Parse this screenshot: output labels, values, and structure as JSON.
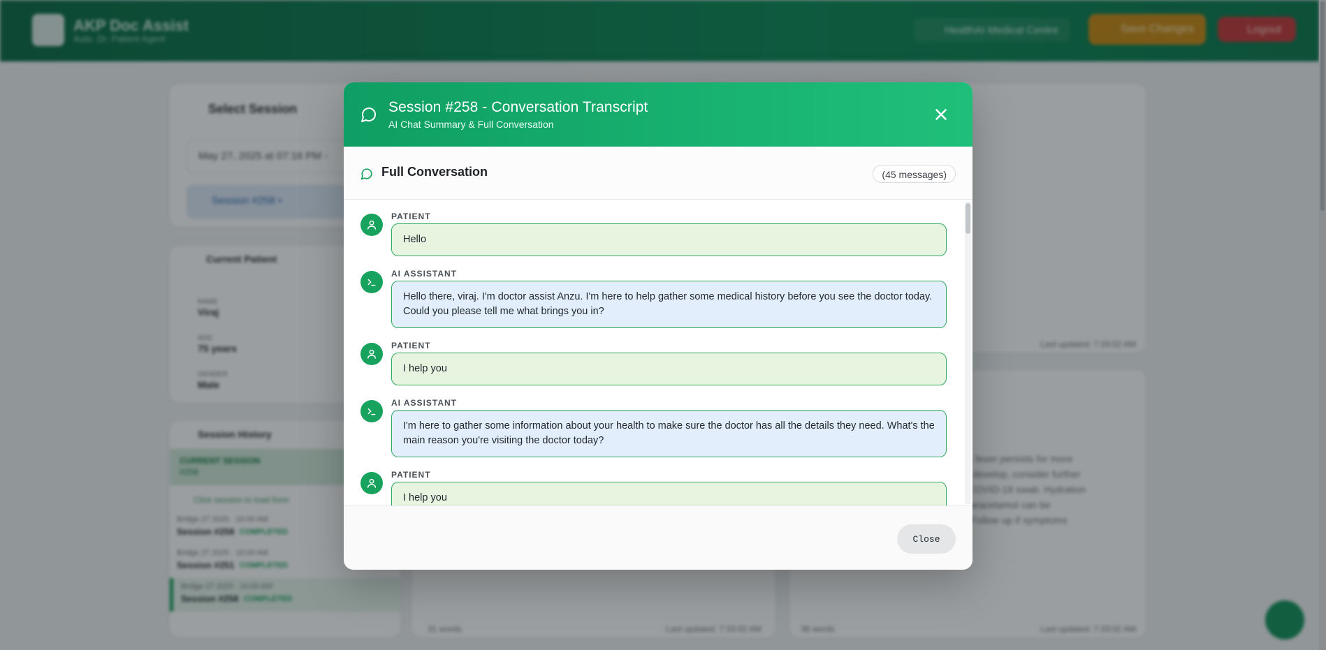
{
  "app": {
    "name": "AKP Doc Assist",
    "tagline": "Auto. Dr. Patient Agent",
    "clinic": "HealthAI Medical Centre",
    "save_label": "Save Changes",
    "logout_label": "Logout"
  },
  "background": {
    "select_session_title": "Select Session",
    "session_select_value": "May 27, 2025 at 07:16 PM - ",
    "session_pill": "Session #258 • ",
    "current_patient_title": "Current Patient",
    "patient_fields": [
      {
        "label": "NAME",
        "value": "Viraj"
      },
      {
        "label": "AGE",
        "value": "75 years"
      },
      {
        "label": "GENDER",
        "value": "Male"
      }
    ],
    "history_title": "Session History",
    "history_current": "CURRENT SESSION",
    "history_current_id": "#258",
    "history_hint": "Click session to load form",
    "history_items": [
      {
        "date": "Bridge 27 2025 · 10:00 AM",
        "title": "Session #258",
        "status": "COMPLETED"
      },
      {
        "date": "Bridge 27 2025 · 10:00 AM",
        "title": "Session #251",
        "status": "COMPLETED"
      },
      {
        "date": "Bridge 27 2025 · 10:00 AM",
        "title": "Session #258",
        "status": "COMPLETED"
      }
    ],
    "right_text": "if the fever persists for more\nable develop, consider further\nd a COVID-19 swab. Hydration\nus paracetamol can be\nres. Follow up if symptoms",
    "last_updated_1": "Last updated: 7:33:02 AM",
    "last_updated_2": "Last updated: 7:33:02 AM",
    "last_updated_3": "Last updated: 7:33:02 AM",
    "words_1": "31 words",
    "words_2": "38 words"
  },
  "modal": {
    "title": "Session #258 - Conversation Transcript",
    "subtitle": "AI Chat Summary & Full Conversation",
    "section_title": "Full Conversation",
    "message_count": "(45 messages)",
    "close_label": "Close",
    "messages": [
      {
        "role": "PATIENT",
        "type": "patient",
        "text": "Hello"
      },
      {
        "role": "AI ASSISTANT",
        "type": "ai",
        "text": "Hello there, viraj. I'm doctor assist Anzu. I'm here to help gather some medical history before you see the doctor today. Could you please tell me what brings you in?"
      },
      {
        "role": "PATIENT",
        "type": "patient",
        "text": "I help you"
      },
      {
        "role": "AI ASSISTANT",
        "type": "ai",
        "text": "I'm here to gather some information about your health to make sure the doctor has all the details they need. What's the main reason you're visiting the doctor today?"
      },
      {
        "role": "PATIENT",
        "type": "patient",
        "text": "I help you"
      }
    ]
  },
  "colors": {
    "brand_green": "#17a35e",
    "patient_bubble": "#e6f4e0",
    "ai_bubble": "#e3eefc"
  }
}
